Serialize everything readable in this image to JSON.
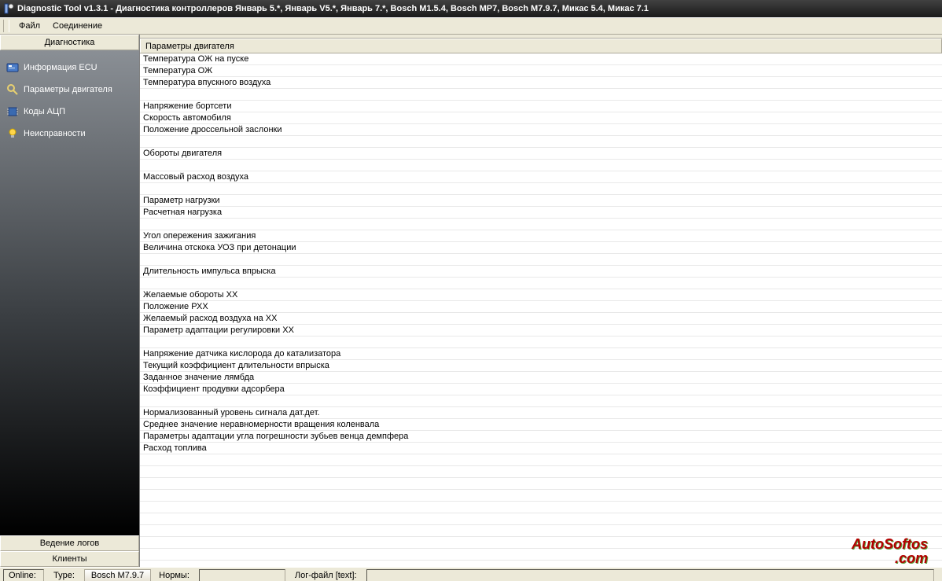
{
  "title": "Diagnostic Tool v1.3.1 - Диагностика контроллеров Январь 5.*, Январь V5.*, Январь 7.*, Bosch M1.5.4, Bosch MP7, Bosch M7.9.7, Микас 5.4, Микас 7.1",
  "menubar": {
    "items": [
      "Файл",
      "Соединение"
    ]
  },
  "sidebar": {
    "header": "Диагностика",
    "nav": [
      {
        "label": "Информация ECU",
        "icon": "info"
      },
      {
        "label": "Параметры двигателя",
        "icon": "search"
      },
      {
        "label": "Коды АЦП",
        "icon": "chip"
      },
      {
        "label": "Неисправности",
        "icon": "bulb"
      }
    ],
    "footer": [
      "Ведение логов",
      "Клиенты"
    ]
  },
  "grid": {
    "column_header": "Параметры двигателя",
    "rows": [
      "Температура ОЖ на пуске",
      "Температура ОЖ",
      "Температура впускного воздуха",
      "",
      "Напряжение бортсети",
      "Скорость автомобиля",
      "Положение дроссельной заслонки",
      "",
      "Обороты двигателя",
      "",
      "Массовый расход воздуха",
      "",
      "Параметр нагрузки",
      "Расчетная нагрузка",
      "",
      "Угол опережения зажигания",
      "Величина отскока УОЗ при детонации",
      "",
      "Длительность импульса впрыска",
      "",
      "Желаемые обороты ХХ",
      "Положение РХХ",
      "Желаемый расход воздуха на ХХ",
      "Параметр адаптации регулировки ХХ",
      "",
      "Напряжение датчика кислорода до катализатора",
      "Текущий коэффициент длительности впрыска",
      "Заданное значение лямбда",
      "Коэффициент продувки адсорбера",
      "",
      "Нормализованный уровень сигнала дат.дет.",
      "Среднее значение неравномерности вращения коленвала",
      "Параметры адаптации угла погрешности зубьев венца демпфера",
      "Расход топлива",
      "",
      "",
      "",
      "",
      "",
      "",
      "",
      "",
      "",
      ""
    ]
  },
  "status": {
    "online_label": "Online:",
    "type_label": "Type:",
    "type_value": "Bosch M7.9.7",
    "norms_label": "Нормы:",
    "log_label": "Лог-файл [text]:"
  },
  "watermark": {
    "line1": "AutoSoftos",
    "line2": ".com"
  }
}
